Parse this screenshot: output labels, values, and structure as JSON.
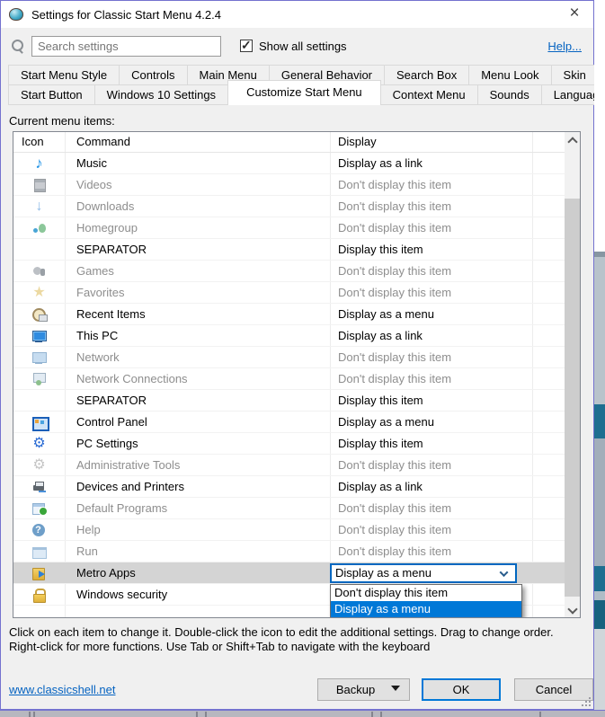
{
  "window": {
    "title": "Settings for Classic Start Menu 4.2.4"
  },
  "toolbar": {
    "search_placeholder": "Search settings",
    "show_all_label": "Show all settings",
    "show_all_checked": true,
    "help_label": "Help..."
  },
  "tabs": {
    "row1": [
      "Start Menu Style",
      "Controls",
      "Main Menu",
      "General Behavior",
      "Search Box",
      "Menu Look",
      "Skin"
    ],
    "row2": [
      "Start Button",
      "Windows 10 Settings",
      "Customize Start Menu",
      "Context Menu",
      "Sounds",
      "Language"
    ],
    "active": "Customize Start Menu"
  },
  "list": {
    "label": "Current menu items:",
    "columns": [
      "Icon",
      "Command",
      "Display"
    ],
    "rows": [
      {
        "icon": "music-note",
        "command": "Music",
        "display": "Display as a link",
        "state": "normal"
      },
      {
        "icon": "film",
        "command": "Videos",
        "display": "Don't display this item",
        "state": "disabled"
      },
      {
        "icon": "download-arrow",
        "command": "Downloads",
        "display": "Don't display this item",
        "state": "disabled"
      },
      {
        "icon": "homegroup",
        "command": "Homegroup",
        "display": "Don't display this item",
        "state": "disabled"
      },
      {
        "icon": "",
        "command": "SEPARATOR",
        "display": "Display this item",
        "state": "normal"
      },
      {
        "icon": "games",
        "command": "Games",
        "display": "Don't display this item",
        "state": "disabled"
      },
      {
        "icon": "favorites-star",
        "command": "Favorites",
        "display": "Don't display this item",
        "state": "disabled"
      },
      {
        "icon": "recent-items",
        "command": "Recent Items",
        "display": "Display as a menu",
        "state": "normal"
      },
      {
        "icon": "this-pc",
        "command": "This PC",
        "display": "Display as a link",
        "state": "normal"
      },
      {
        "icon": "network",
        "command": "Network",
        "display": "Don't display this item",
        "state": "disabled"
      },
      {
        "icon": "network-connections",
        "command": "Network Connections",
        "display": "Don't display this item",
        "state": "disabled"
      },
      {
        "icon": "",
        "command": "SEPARATOR",
        "display": "Display this item",
        "state": "normal"
      },
      {
        "icon": "control-panel",
        "command": "Control Panel",
        "display": "Display as a menu",
        "state": "normal"
      },
      {
        "icon": "gear",
        "command": "PC Settings",
        "display": "Display this item",
        "state": "normal"
      },
      {
        "icon": "admin-tools",
        "command": "Administrative Tools",
        "display": "Don't display this item",
        "state": "disabled"
      },
      {
        "icon": "printer",
        "command": "Devices and Printers",
        "display": "Display as a link",
        "state": "normal"
      },
      {
        "icon": "default-programs",
        "command": "Default Programs",
        "display": "Don't display this item",
        "state": "disabled"
      },
      {
        "icon": "help",
        "command": "Help",
        "display": "Don't display this item",
        "state": "disabled"
      },
      {
        "icon": "run-window",
        "command": "Run",
        "display": "Don't display this item",
        "state": "disabled"
      },
      {
        "icon": "metro-folder",
        "command": "Metro Apps",
        "display": "",
        "state": "selected",
        "has_combobox": true
      },
      {
        "icon": "lock",
        "command": "Windows security",
        "display": "",
        "state": "normal"
      }
    ],
    "combobox": {
      "value": "Display as a menu",
      "options": [
        "Don't display this item",
        "Display as a menu"
      ],
      "highlighted": "Display as a menu"
    }
  },
  "footer": {
    "line1": "Click on each item to change it. Double-click the icon to edit the additional settings. Drag to change order.",
    "line2": "Right-click for more functions. Use Tab or Shift+Tab to navigate with the keyboard"
  },
  "bottom": {
    "website": "www.classicshell.net",
    "backup_label": "Backup",
    "ok_label": "OK",
    "cancel_label": "Cancel"
  },
  "colors": {
    "accent": "#0078d7",
    "combobox_border": "#0067c0",
    "link": "#0563c1",
    "dropdown_highlight": "#0078d7"
  }
}
